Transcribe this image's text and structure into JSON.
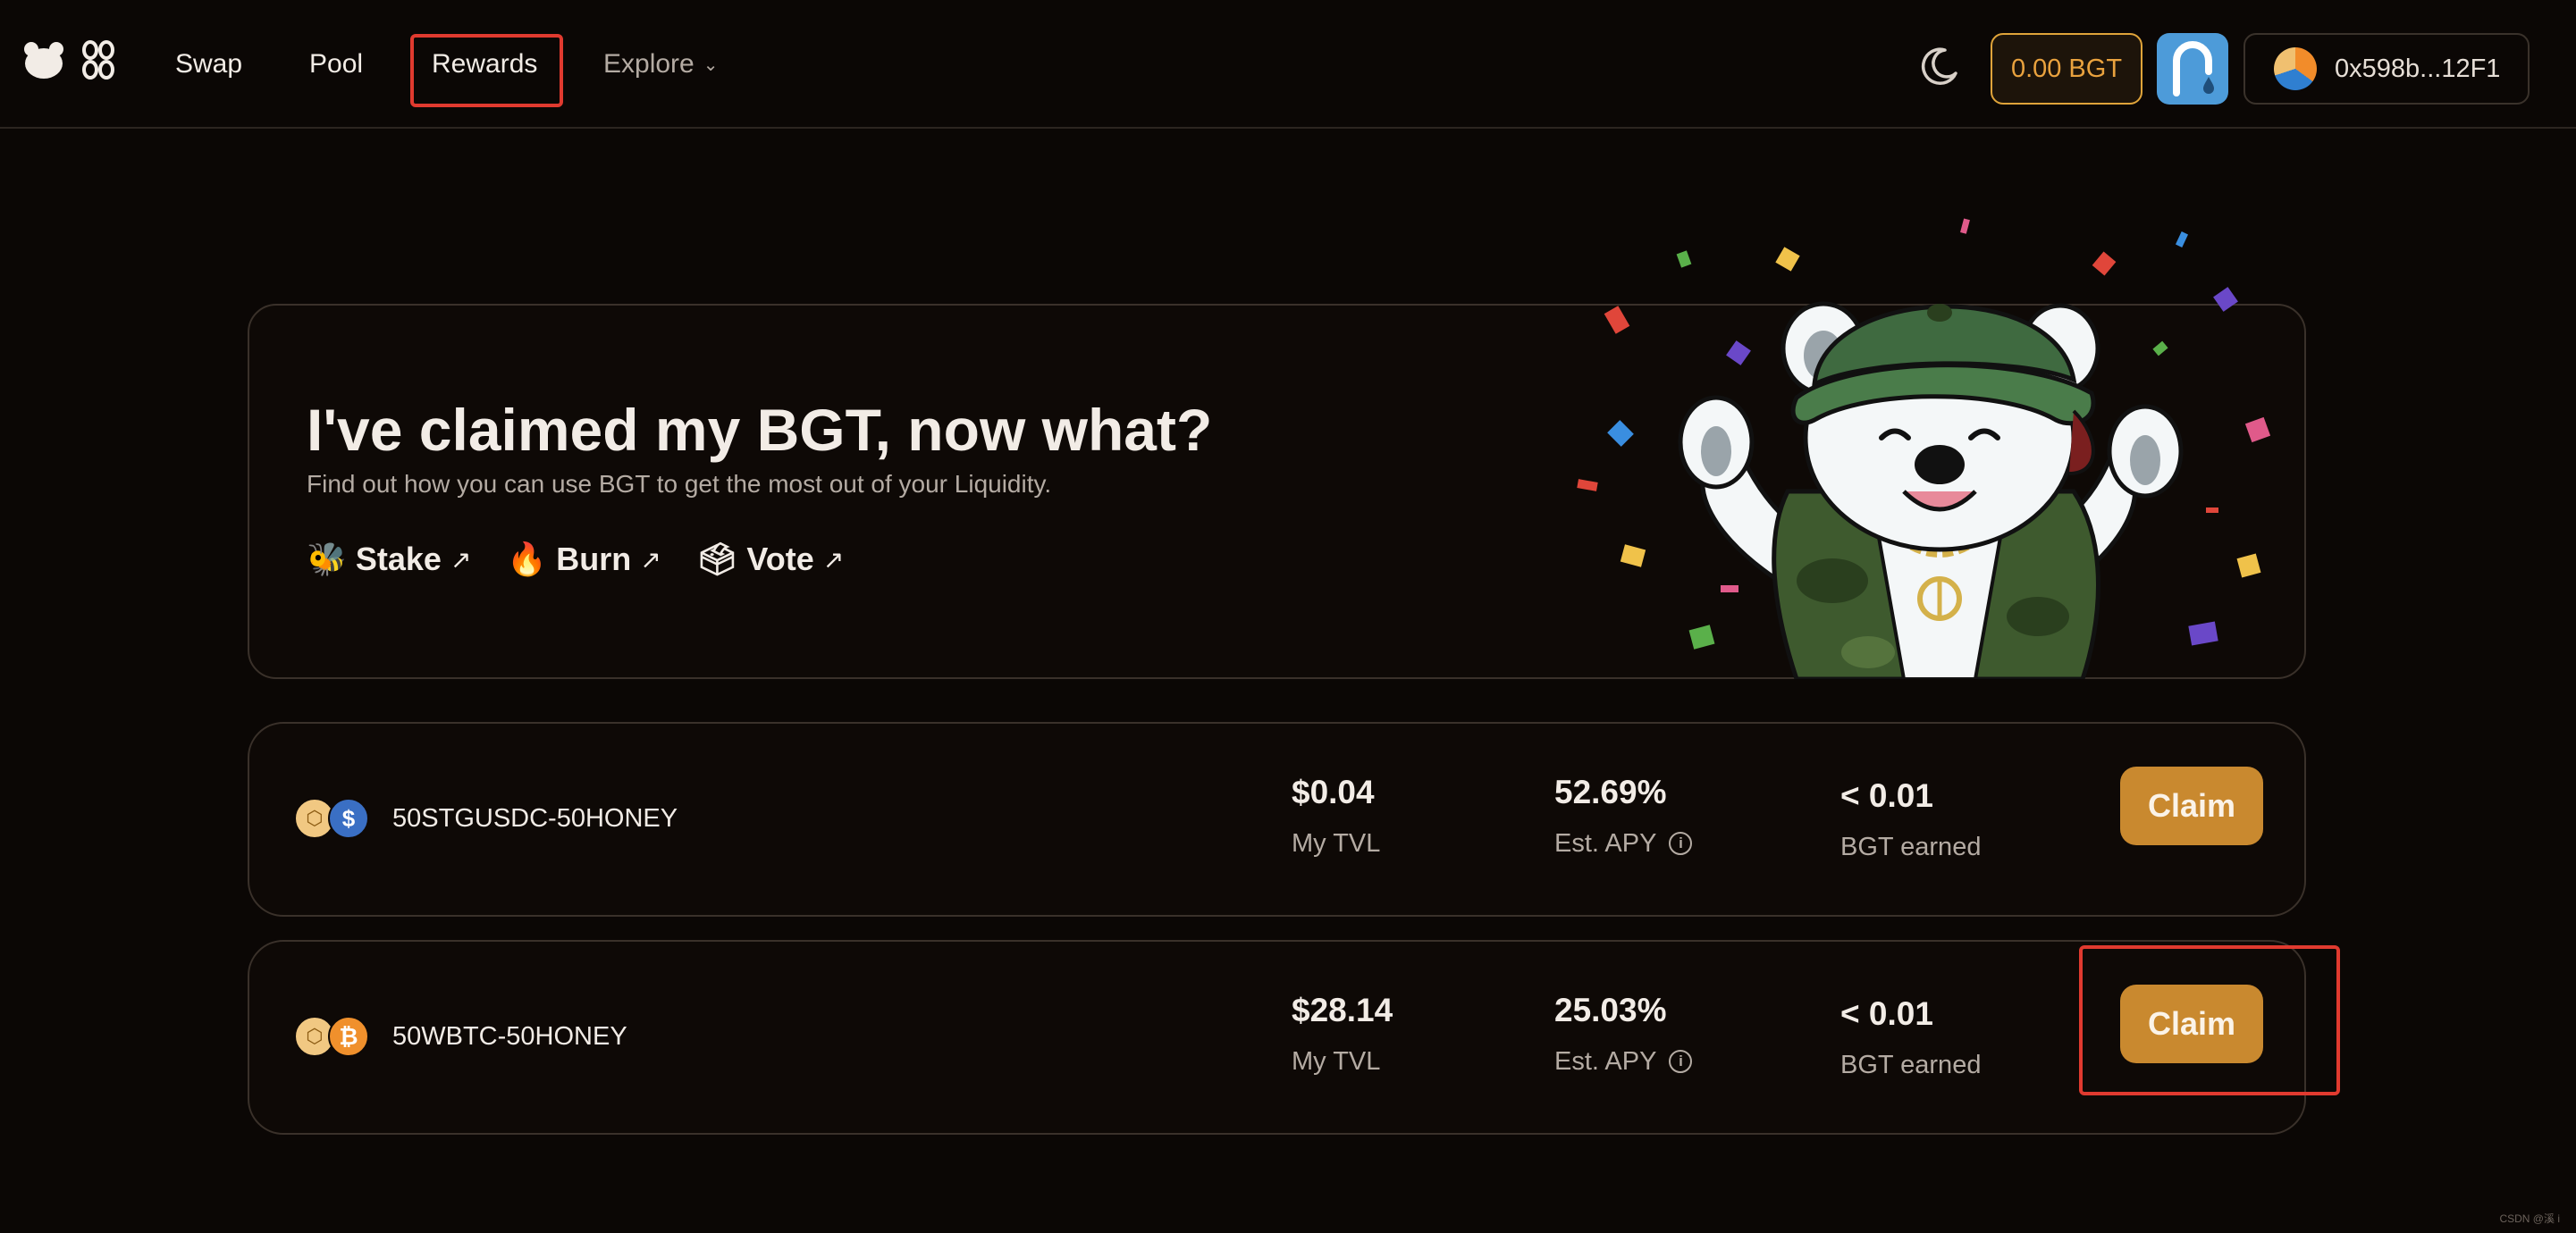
{
  "nav": {
    "links": [
      {
        "label": "Swap"
      },
      {
        "label": "Pool"
      },
      {
        "label": "Rewards"
      },
      {
        "label": "Explore"
      }
    ],
    "bgt_balance": "0.00 BGT",
    "wallet_address": "0x598b...12F1"
  },
  "hero": {
    "title": "I've claimed my BGT, now what?",
    "subtitle": "Find out how you can use BGT to get the most out of your Liquidity.",
    "links": [
      {
        "emoji": "🐝",
        "label": "Stake"
      },
      {
        "emoji": "🔥",
        "label": "Burn"
      },
      {
        "emoji": "🗳",
        "label": "Vote"
      }
    ]
  },
  "rewards": [
    {
      "pair": "50STGUSDC-50HONEY",
      "tvl_value": "$0.04",
      "tvl_label": "My TVL",
      "apy_value": "52.69%",
      "apy_label": "Est. APY",
      "earned_value": "< 0.01",
      "earned_label": "BGT earned",
      "claim_label": "Claim",
      "icons": [
        "honey-token-icon",
        "usdc-token-icon"
      ]
    },
    {
      "pair": "50WBTC-50HONEY",
      "tvl_value": "$28.14",
      "tvl_label": "My TVL",
      "apy_value": "25.03%",
      "apy_label": "Est. APY",
      "earned_value": "< 0.01",
      "earned_label": "BGT earned",
      "claim_label": "Claim",
      "icons": [
        "honey-token-icon",
        "btc-token-icon"
      ]
    }
  ],
  "watermark": "CSDN @溪 i",
  "colors": {
    "background": "#0b0705",
    "accent_gold": "#c9892f",
    "bgt_pill": "#e9a23e",
    "highlight_red": "#e03a2f",
    "faucet_blue": "#4d9bd9"
  }
}
